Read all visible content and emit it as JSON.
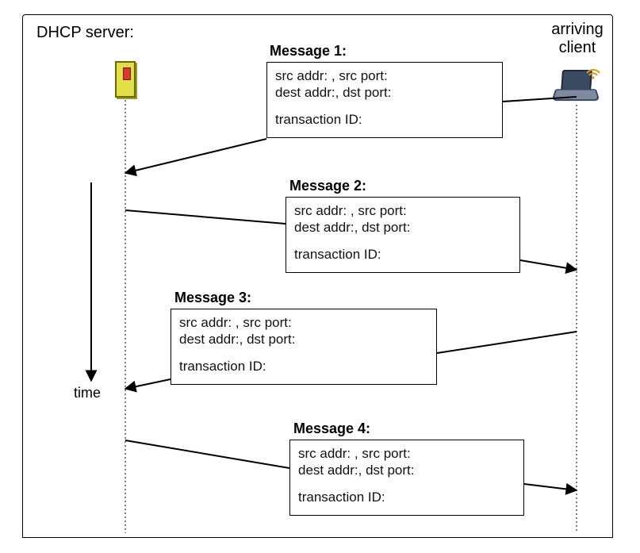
{
  "header": {
    "server_label": "DHCP server:",
    "client_label_line1": "arriving",
    "client_label_line2": "client"
  },
  "time_label": "time",
  "messages": [
    {
      "title": "Message 1:",
      "src_addr_label": "src addr:",
      "src_port_label": "src port:",
      "dest_addr_label": "dest addr:",
      "dst_port_label": "dst port:",
      "transaction_label": "transaction ID:"
    },
    {
      "title": "Message 2:",
      "src_addr_label": "src addr:",
      "src_port_label": "src port:",
      "dest_addr_label": "dest addr:",
      "dst_port_label": "dst port:",
      "transaction_label": "transaction ID:"
    },
    {
      "title": "Message 3:",
      "src_addr_label": "src addr:",
      "src_port_label": "src port:",
      "dest_addr_label": "dest addr:",
      "dst_port_label": "dst port:",
      "transaction_label": "transaction ID:"
    },
    {
      "title": "Message 4:",
      "src_addr_label": "src addr:",
      "src_port_label": "src port:",
      "dest_addr_label": "dest addr:",
      "dst_port_label": "dst port:",
      "transaction_label": "transaction ID:"
    }
  ],
  "icons": {
    "server": "server-icon",
    "laptop": "laptop-icon",
    "wifi": "wifi-icon"
  }
}
